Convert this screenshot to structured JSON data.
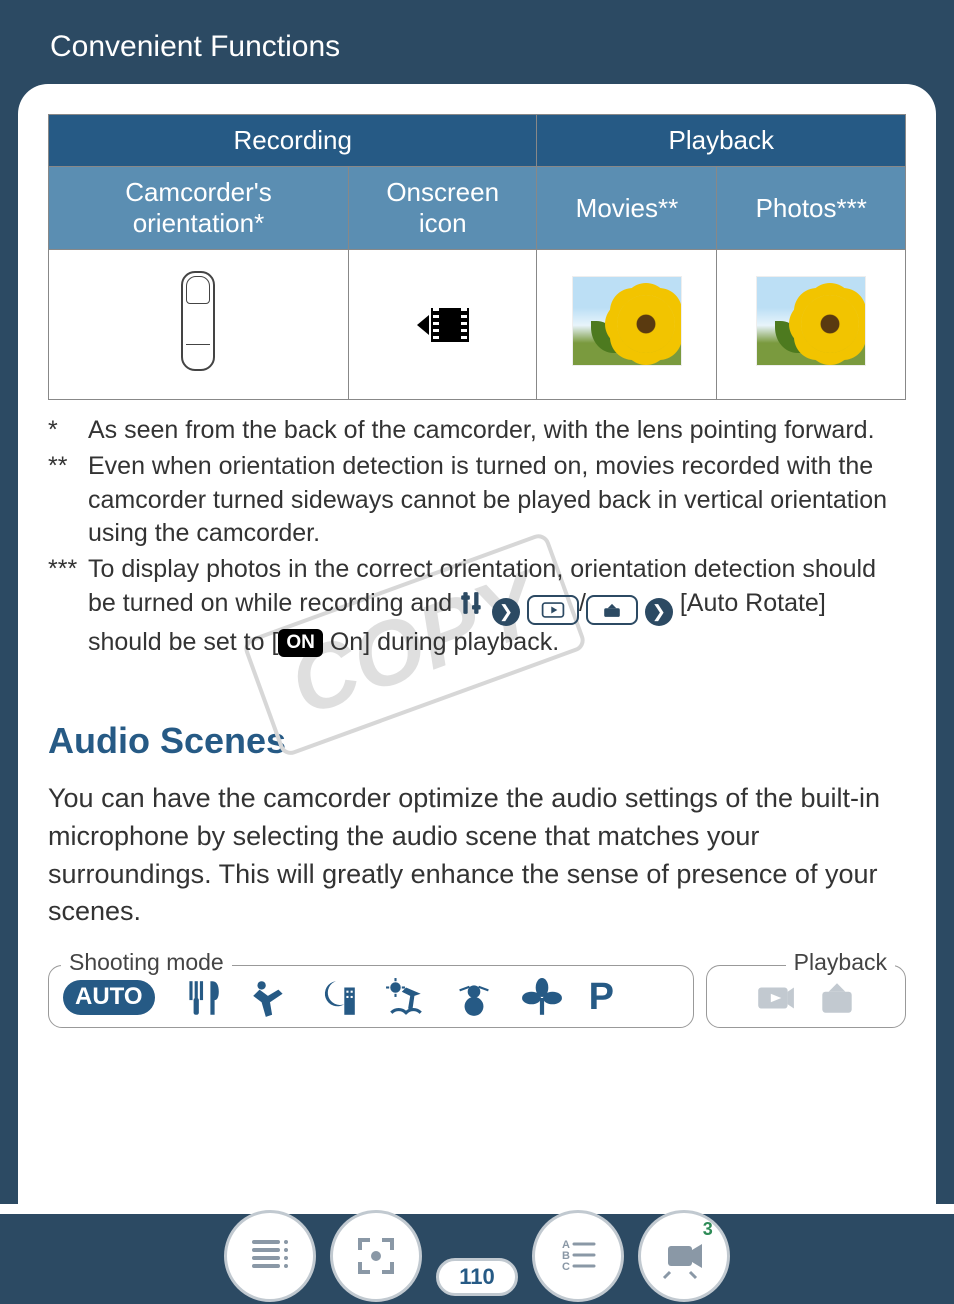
{
  "header": {
    "title": "Convenient Functions"
  },
  "table": {
    "head": {
      "recording": "Recording",
      "playback": "Playback"
    },
    "sub": {
      "orientation": "Camcorder's\norientation*",
      "onscreen": "Onscreen\nicon",
      "movies": "Movies**",
      "photos": "Photos***"
    }
  },
  "footnotes": {
    "f1_mark": "*",
    "f1": "As seen from the back of the camcorder, with the lens pointing forward.",
    "f2_mark": "**",
    "f2": "Even when orientation detection is turned on, movies recorded with the camcorder turned sideways cannot be played back in vertical orientation using the camcorder.",
    "f3_mark": "***",
    "f3_a": "To display photos in the correct orientation, orientation detection should be turned on while recording and ",
    "f3_slash": "/",
    "f3_b": " [Auto Rotate] should be set to [",
    "on_badge": "ON",
    "f3_c": " On] during playback."
  },
  "section": {
    "title": "Audio Scenes",
    "body": "You can have the camcorder optimize the audio settings of the built-in microphone by selecting the audio scene that matches your surroundings. This will greatly enhance the sense of presence of your scenes."
  },
  "mode_strip": {
    "shoot_label": "Shooting mode",
    "play_label": "Playback",
    "auto": "AUTO",
    "p": "P"
  },
  "footer": {
    "page": "110",
    "badge3": "3"
  }
}
